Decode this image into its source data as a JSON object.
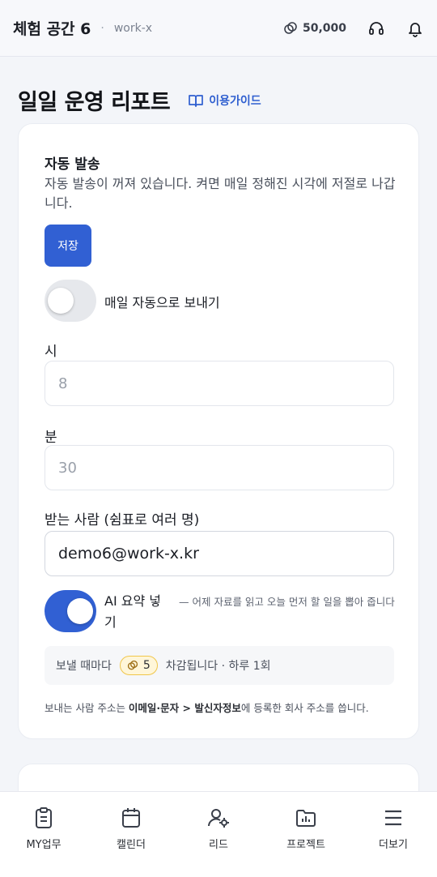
{
  "header": {
    "workspace_name": "체험 공간 6",
    "separator": "·",
    "workspace_slug": "work-x",
    "credits": "50,000",
    "icons": [
      "coin-icon",
      "headset-icon",
      "bell-icon"
    ]
  },
  "page": {
    "title": "일일 운영 리포트",
    "guide_link": "이용가이드"
  },
  "auto_send": {
    "title": "자동 발송",
    "description": "자동 발송이 꺼져 있습니다. 켜면 매일 정해진 시각에 저절로 나갑니다.",
    "save_label": "저장",
    "toggle_label": "매일 자동으로 보내기",
    "toggle_on": false,
    "hour_label": "시",
    "hour_placeholder": "8",
    "minute_label": "분",
    "minute_placeholder": "30",
    "recipients_label": "받는 사람 (쉼표로 여러 명)",
    "recipients_value": "demo6@work-x.kr",
    "ai_summary_label": "AI 요약 넣기",
    "ai_summary_on": true,
    "ai_summary_hint": "— 어제 자료를 읽고 오늘 먼저 할 일을 뽑아 줍니다",
    "cost_prefix": "보낼 때마다",
    "cost_amount": "5",
    "cost_suffix": "차감됩니다 · 하루 1회",
    "footnote_prefix": "보내는 사람 주소는 ",
    "footnote_bold": "이메일·문자 > 발신자정보",
    "footnote_suffix": "에 등록한 회사 주소를 씁니다."
  },
  "bottom_nav": [
    {
      "label": "MY업무",
      "icon": "clipboard-icon"
    },
    {
      "label": "캘린더",
      "icon": "calendar-icon"
    },
    {
      "label": "리드",
      "icon": "user-gear-icon"
    },
    {
      "label": "프로젝트",
      "icon": "folder-chart-icon"
    },
    {
      "label": "더보기",
      "icon": "menu-icon"
    }
  ],
  "colors": {
    "accent": "#3160d3",
    "badge_bg": "#fff6d9",
    "badge_border": "#f0c64a"
  }
}
